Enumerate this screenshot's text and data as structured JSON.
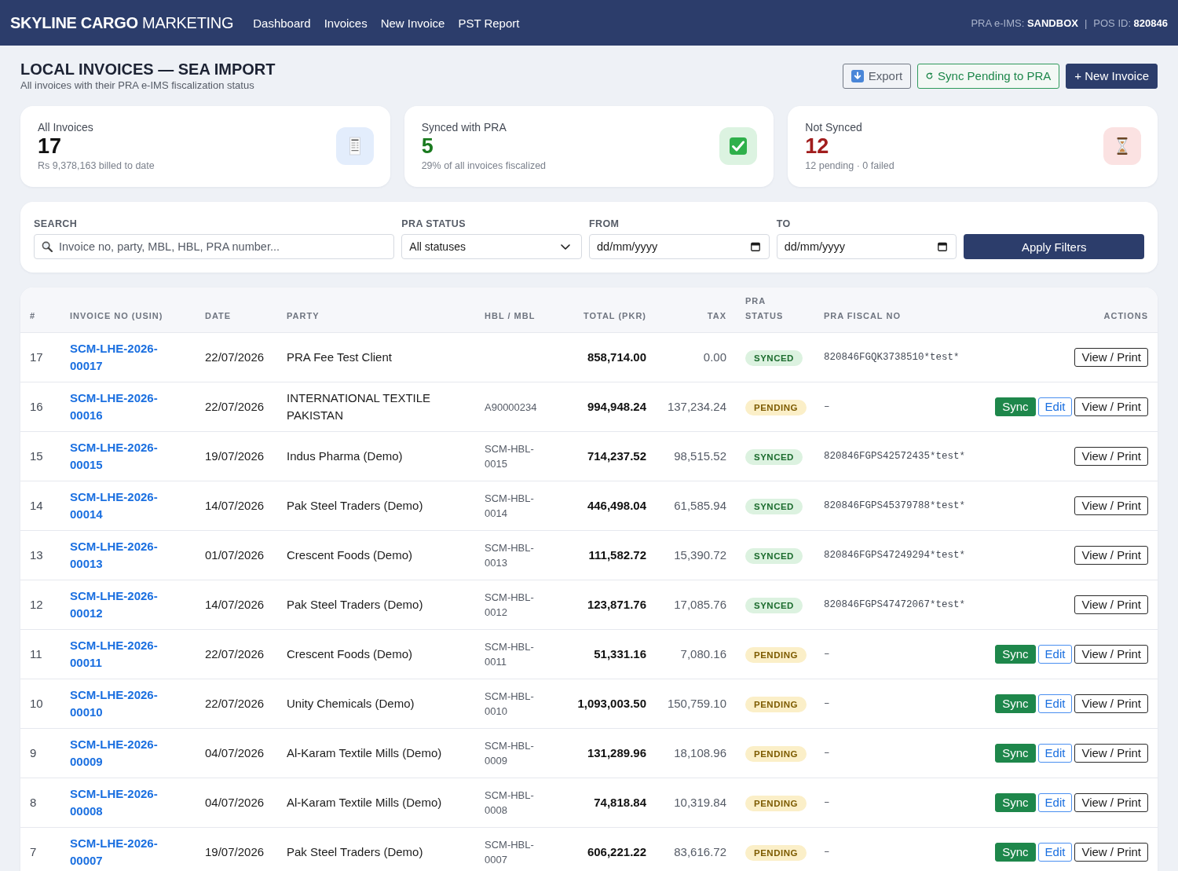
{
  "header": {
    "brand": "**SKYLINE CARGO** MARKETING",
    "nav": [
      {
        "label": "Dashboard"
      },
      {
        "label": "Invoices"
      },
      {
        "label": "New Invoice"
      },
      {
        "label": "PST Report"
      }
    ],
    "environment": "PRA e-IMS: **SANDBOX**",
    "separator": "|",
    "pos_id": "POS ID: **820846**"
  },
  "page": {
    "title": "LOCAL INVOICES — SEA IMPORT",
    "subtitle": "All invoices with their PRA e-IMS fiscalization status"
  },
  "toolbar": [
    {
      "kind": "export",
      "label": "Export"
    },
    {
      "kind": "sync",
      "label": "Sync Pending to PRA"
    },
    {
      "kind": "new",
      "label": "+ New Invoice"
    }
  ],
  "stats": [
    {
      "kind": "total",
      "label": "All Invoices",
      "value": "17",
      "caption": "Rs 9,378,163 billed to date"
    },
    {
      "kind": "synced",
      "label": "Synced with PRA",
      "value": "5",
      "caption": "29% of all invoices fiscalized"
    },
    {
      "kind": "not_synced",
      "label": "Not Synced",
      "value": "12",
      "caption": "12 pending · 0 failed"
    }
  ],
  "filters": {
    "search": {
      "label": "SEARCH",
      "placeholder": "Invoice no, party, MBL, HBL, PRA number..."
    },
    "status": {
      "label": "PRA STATUS",
      "value": "All statuses"
    },
    "from": {
      "label": "FROM",
      "placeholder": "dd/mm/yyyy"
    },
    "to": {
      "label": "TO",
      "placeholder": "dd/mm/yyyy"
    },
    "apply_button": "Apply Filters"
  },
  "table": {
    "columns": [
      "#",
      "INVOICE NO (USIN)",
      "DATE",
      "PARTY",
      "HBL / MBL",
      "TOTAL (PKR)",
      "TAX",
      "PRA STATUS",
      "PRA FISCAL NO",
      "ACTIONS"
    ],
    "rows": [
      {
        "number": "17",
        "invoice_no": "SCM-LHE-2026-00017",
        "date": "22/07/2026",
        "party": "PRA Fee Test Client",
        "total": "858,714.00",
        "tax": "0.00",
        "pra_status": {
          "kind": "synced",
          "label": "SYNCED"
        },
        "fiscal_no": "820846FGQK3738510*test*",
        "actions": [
          {
            "kind": "view",
            "label": "View / Print"
          }
        ]
      },
      {
        "number": "16",
        "invoice_no": "SCM-LHE-2026-00016",
        "date": "22/07/2026",
        "party": "INTERNATIONAL TEXTILE PAKISTAN",
        "hbl_mbl": "A90000234",
        "total": "994,948.24",
        "tax": "137,234.24",
        "pra_status": {
          "kind": "pending",
          "label": "PENDING"
        },
        "fiscal_no": "–",
        "actions": [
          {
            "kind": "sync",
            "label": "Sync"
          },
          {
            "kind": "edit",
            "label": "Edit"
          },
          {
            "kind": "view",
            "label": "View / Print"
          }
        ]
      },
      {
        "number": "15",
        "invoice_no": "SCM-LHE-2026-00015",
        "date": "19/07/2026",
        "party": "Indus Pharma (Demo)",
        "hbl_mbl": "SCM-HBL-0015",
        "total": "714,237.52",
        "tax": "98,515.52",
        "pra_status": {
          "kind": "synced",
          "label": "SYNCED"
        },
        "fiscal_no": "820846FGPS42572435*test*",
        "actions": [
          {
            "kind": "view",
            "label": "View / Print"
          }
        ]
      },
      {
        "number": "14",
        "invoice_no": "SCM-LHE-2026-00014",
        "date": "14/07/2026",
        "party": "Pak Steel Traders (Demo)",
        "hbl_mbl": "SCM-HBL-0014",
        "total": "446,498.04",
        "tax": "61,585.94",
        "pra_status": {
          "kind": "synced",
          "label": "SYNCED"
        },
        "fiscal_no": "820846FGPS45379788*test*",
        "actions": [
          {
            "kind": "view",
            "label": "View / Print"
          }
        ]
      },
      {
        "number": "13",
        "invoice_no": "SCM-LHE-2026-00013",
        "date": "01/07/2026",
        "party": "Crescent Foods (Demo)",
        "hbl_mbl": "SCM-HBL-0013",
        "total": "111,582.72",
        "tax": "15,390.72",
        "pra_status": {
          "kind": "synced",
          "label": "SYNCED"
        },
        "fiscal_no": "820846FGPS47249294*test*",
        "actions": [
          {
            "kind": "view",
            "label": "View / Print"
          }
        ]
      },
      {
        "number": "12",
        "invoice_no": "SCM-LHE-2026-00012",
        "date": "14/07/2026",
        "party": "Pak Steel Traders (Demo)",
        "hbl_mbl": "SCM-HBL-0012",
        "total": "123,871.76",
        "tax": "17,085.76",
        "pra_status": {
          "kind": "synced",
          "label": "SYNCED"
        },
        "fiscal_no": "820846FGPS47472067*test*",
        "actions": [
          {
            "kind": "view",
            "label": "View / Print"
          }
        ]
      },
      {
        "number": "11",
        "invoice_no": "SCM-LHE-2026-00011",
        "date": "22/07/2026",
        "party": "Crescent Foods (Demo)",
        "hbl_mbl": "SCM-HBL-0011",
        "total": "51,331.16",
        "tax": "7,080.16",
        "pra_status": {
          "kind": "pending",
          "label": "PENDING"
        },
        "fiscal_no": "–",
        "actions": [
          {
            "kind": "sync",
            "label": "Sync"
          },
          {
            "kind": "edit",
            "label": "Edit"
          },
          {
            "kind": "view",
            "label": "View / Print"
          }
        ]
      },
      {
        "number": "10",
        "invoice_no": "SCM-LHE-2026-00010",
        "date": "22/07/2026",
        "party": "Unity Chemicals (Demo)",
        "hbl_mbl": "SCM-HBL-0010",
        "total": "1,093,003.50",
        "tax": "150,759.10",
        "pra_status": {
          "kind": "pending",
          "label": "PENDING"
        },
        "fiscal_no": "–",
        "actions": [
          {
            "kind": "sync",
            "label": "Sync"
          },
          {
            "kind": "edit",
            "label": "Edit"
          },
          {
            "kind": "view",
            "label": "View / Print"
          }
        ]
      },
      {
        "number": "9",
        "invoice_no": "SCM-LHE-2026-00009",
        "date": "04/07/2026",
        "party": "Al-Karam Textile Mills (Demo)",
        "hbl_mbl": "SCM-HBL-0009",
        "total": "131,289.96",
        "tax": "18,108.96",
        "pra_status": {
          "kind": "pending",
          "label": "PENDING"
        },
        "fiscal_no": "–",
        "actions": [
          {
            "kind": "sync",
            "label": "Sync"
          },
          {
            "kind": "edit",
            "label": "Edit"
          },
          {
            "kind": "view",
            "label": "View / Print"
          }
        ]
      },
      {
        "number": "8",
        "invoice_no": "SCM-LHE-2026-00008",
        "date": "04/07/2026",
        "party": "Al-Karam Textile Mills (Demo)",
        "hbl_mbl": "SCM-HBL-0008",
        "total": "74,818.84",
        "tax": "10,319.84",
        "pra_status": {
          "kind": "pending",
          "label": "PENDING"
        },
        "fiscal_no": "–",
        "actions": [
          {
            "kind": "sync",
            "label": "Sync"
          },
          {
            "kind": "edit",
            "label": "Edit"
          },
          {
            "kind": "view",
            "label": "View / Print"
          }
        ]
      },
      {
        "number": "7",
        "invoice_no": "SCM-LHE-2026-00007",
        "date": "19/07/2026",
        "party": "Pak Steel Traders (Demo)",
        "hbl_mbl": "SCM-HBL-0007",
        "total": "606,221.22",
        "tax": "83,616.72",
        "pra_status": {
          "kind": "pending",
          "label": "PENDING"
        },
        "fiscal_no": "–",
        "actions": [
          {
            "kind": "sync",
            "label": "Sync"
          },
          {
            "kind": "edit",
            "label": "Edit"
          },
          {
            "kind": "view",
            "label": "View / Print"
          }
        ]
      }
    ]
  }
}
